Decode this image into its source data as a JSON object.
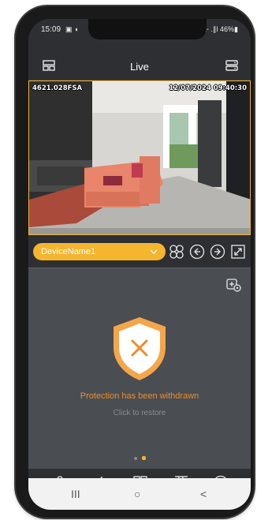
{
  "status_bar": {
    "time": "15:09",
    "notification_icons": "▣ ◖",
    "right": "⊹ .∥l 46%▮"
  },
  "top_bar": {
    "title": "Live",
    "left_icon": "grid-layout-icon",
    "right_icon": "device-list-icon"
  },
  "video": {
    "osd_left": "4621.028FSA",
    "osd_right": "12/07/2024 09:40:30",
    "accent_color": "#f2b233"
  },
  "device_selector": {
    "label": "DeviceName1",
    "color": "#f5b52e"
  },
  "control_icons": [
    "ptz-control-icon",
    "previous-icon",
    "next-icon",
    "fullscreen-icon"
  ],
  "content": {
    "add_camera_icon": "add-camera-icon",
    "shield_icon": "shield-x-icon",
    "warning_text": "Protection has been withdrawn",
    "restore_text": "Click to restore",
    "warning_color": "#e8902e",
    "page_count": 2,
    "active_page": 2
  },
  "bottom_bar": {
    "icons": [
      "microphone-icon",
      "speaker-icon",
      "multi-view-icon",
      "playback-icon",
      "more-icon"
    ]
  },
  "nav_bar": {
    "recent": "III",
    "home": "○",
    "back": "<"
  }
}
